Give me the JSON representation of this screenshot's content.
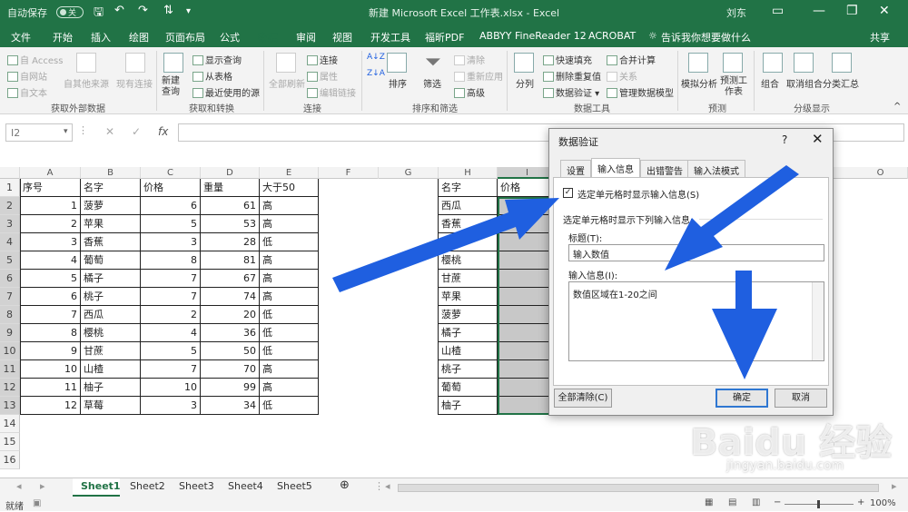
{
  "titlebar": {
    "autosave_label": "自动保存",
    "autosave_state": "关",
    "doc_title": "新建 Microsoft Excel 工作表.xlsx - Excel",
    "user": "刘东"
  },
  "ribbon_tabs": [
    "文件",
    "开始",
    "插入",
    "绘图",
    "页面布局",
    "公式",
    "数据",
    "审阅",
    "视图",
    "开发工具",
    "福昕PDF",
    "ABBYY FineReader 12",
    "ACROBAT",
    "告诉我你想要做什么"
  ],
  "share_label": "共享",
  "ribbon": {
    "get_external": {
      "access": "自 Access",
      "web": "自网站",
      "text": "自文本",
      "other": "自其他来源",
      "existing": "现有连接",
      "label": "获取外部数据"
    },
    "transform": {
      "new_query": "新建查询",
      "show_queries": "显示查询",
      "from_table": "从表格",
      "recent_sources": "最近使用的源",
      "label": "获取和转换"
    },
    "connections": {
      "refresh_all": "全部刷新",
      "connections": "连接",
      "properties": "属性",
      "edit_links": "编辑链接",
      "label": "连接"
    },
    "sort_filter": {
      "sort": "排序",
      "filter": "筛选",
      "clear": "清除",
      "reapply": "重新应用",
      "advanced": "高级",
      "label": "排序和筛选"
    },
    "data_tools": {
      "split": "分列",
      "flash_fill": "快速填充",
      "remove_dup": "删除重复值",
      "validation": "数据验证",
      "consolidate": "合并计算",
      "relations": "关系",
      "manage_model": "管理数据模型",
      "label": "数据工具"
    },
    "forecast": {
      "what_if": "模拟分析",
      "forecast_sheet": "预测工作表",
      "label": "预测"
    },
    "outline": {
      "group": "组合",
      "ungroup": "取消组合",
      "subtotal": "分类汇总",
      "label": "分级显示"
    }
  },
  "formula_bar": {
    "name_box": "I2",
    "fx": "fx"
  },
  "columns": [
    "A",
    "B",
    "C",
    "D",
    "E",
    "F",
    "G",
    "H",
    "I",
    "O"
  ],
  "rows": [
    "1",
    "2",
    "3",
    "4",
    "5",
    "6",
    "7",
    "8",
    "9",
    "10",
    "11",
    "12",
    "13",
    "14",
    "15",
    "16"
  ],
  "table1": {
    "headers": [
      "序号",
      "名字",
      "价格",
      "重量",
      "大于50"
    ],
    "rows": [
      [
        "1",
        "菠萝",
        "6",
        "61",
        "高"
      ],
      [
        "2",
        "苹果",
        "5",
        "53",
        "高"
      ],
      [
        "3",
        "香蕉",
        "3",
        "28",
        "低"
      ],
      [
        "4",
        "葡萄",
        "8",
        "81",
        "高"
      ],
      [
        "5",
        "橘子",
        "7",
        "67",
        "高"
      ],
      [
        "6",
        "桃子",
        "7",
        "74",
        "高"
      ],
      [
        "7",
        "西瓜",
        "2",
        "20",
        "低"
      ],
      [
        "8",
        "樱桃",
        "4",
        "36",
        "低"
      ],
      [
        "9",
        "甘蔗",
        "5",
        "50",
        "低"
      ],
      [
        "10",
        "山楂",
        "7",
        "70",
        "高"
      ],
      [
        "11",
        "柚子",
        "10",
        "99",
        "高"
      ],
      [
        "12",
        "草莓",
        "3",
        "34",
        "低"
      ]
    ]
  },
  "table2": {
    "headers": [
      "名字",
      "价格"
    ],
    "names": [
      "西瓜",
      "香蕉",
      "草莓",
      "樱桃",
      "甘蔗",
      "苹果",
      "菠萝",
      "橘子",
      "山楂",
      "桃子",
      "葡萄",
      "柚子"
    ]
  },
  "sheet_tabs": [
    "Sheet1",
    "Sheet2",
    "Sheet3",
    "Sheet4",
    "Sheet5"
  ],
  "status": {
    "mode": "就绪",
    "zoom": "100%"
  },
  "dialog": {
    "title": "数据验证",
    "help": "?",
    "close": "✕",
    "tabs": [
      "设置",
      "输入信息",
      "出错警告",
      "输入法模式"
    ],
    "show_input_checkbox": "选定单元格时显示输入信息(S)",
    "section_label": "选定单元格时显示下列输入信息:",
    "title_label": "标题(T):",
    "title_value": "输入数值",
    "message_label": "输入信息(I):",
    "message_value": "数值区域在1-20之间",
    "clear_all": "全部清除(C)",
    "ok": "确定",
    "cancel": "取消"
  },
  "watermark": {
    "brand": "Baidu 经验",
    "url": "jingyan.baidu.com"
  },
  "colors": {
    "excel_green": "#217346",
    "arrow_blue": "#1f5fe0",
    "selection_gray": "#c8c8c8"
  }
}
